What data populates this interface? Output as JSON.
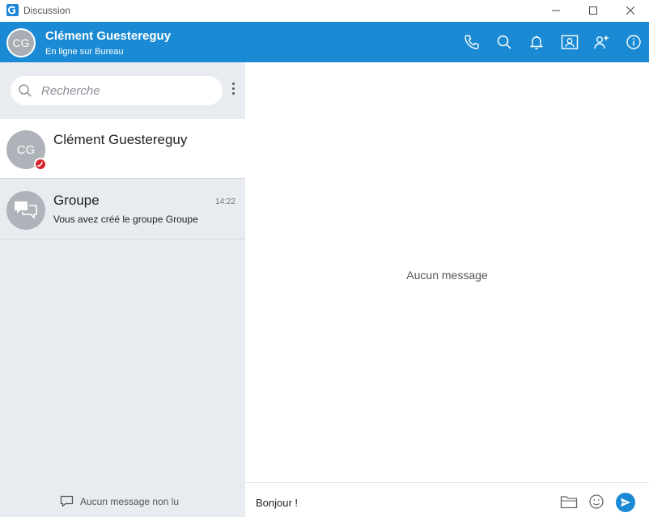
{
  "window": {
    "title": "Discussion"
  },
  "header": {
    "avatar_initials": "CG",
    "name": "Clément Guestereguy",
    "status": "En ligne sur Bureau"
  },
  "sidebar": {
    "search_placeholder": "Recherche",
    "conversations": [
      {
        "initials": "CG",
        "name": "Clément Guestereguy",
        "time": "",
        "preview": ""
      },
      {
        "name": "Groupe",
        "time": "14:22",
        "preview": "Vous avez créé le groupe Groupe"
      }
    ],
    "unread_label": "Aucun message non lu"
  },
  "main": {
    "empty_label": "Aucun message"
  },
  "composer": {
    "text": "Bonjour !"
  },
  "colors": {
    "accent": "#1a8ad4",
    "sidebar": "#e8ebf0",
    "status_busy": "#d8242a"
  }
}
